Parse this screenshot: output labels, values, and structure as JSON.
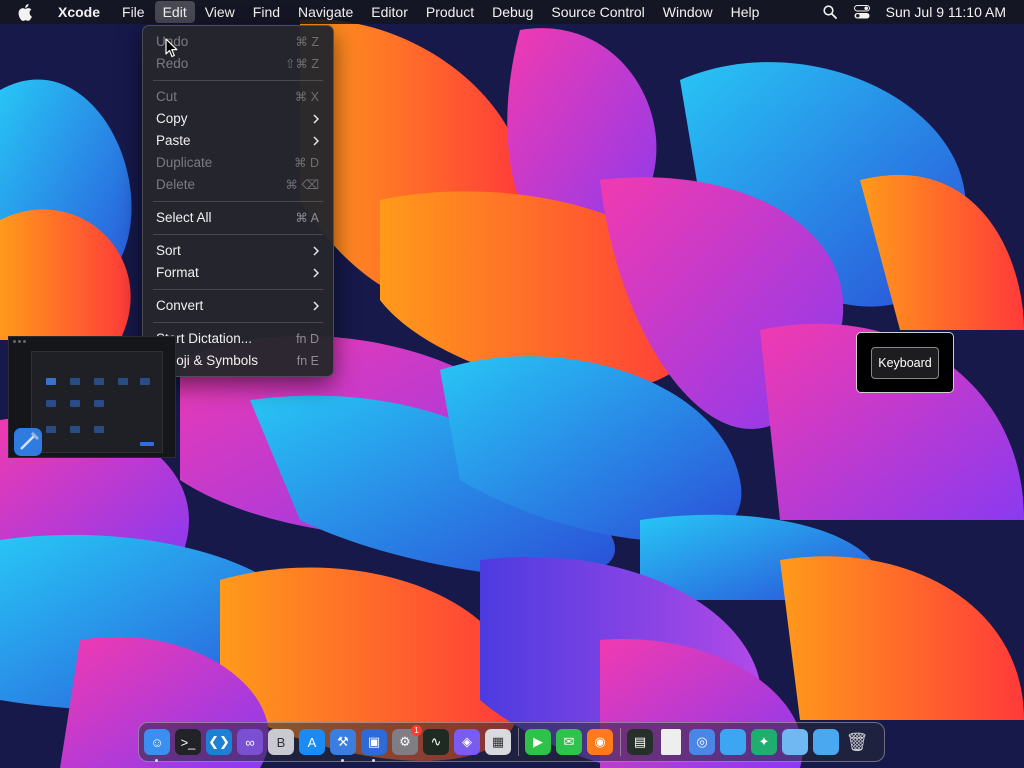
{
  "menubar": {
    "app_name": "Xcode",
    "items": [
      "File",
      "Edit",
      "View",
      "Find",
      "Navigate",
      "Editor",
      "Product",
      "Debug",
      "Source Control",
      "Window",
      "Help"
    ],
    "active_item": "Edit",
    "clock": "Sun Jul 9  11:10 AM"
  },
  "edit_menu": {
    "items": [
      {
        "label": "Undo",
        "shortcut": "⌘ Z",
        "disabled": true
      },
      {
        "label": "Redo",
        "shortcut": "⇧⌘ Z",
        "disabled": true
      },
      {
        "label": "Cut",
        "shortcut": "⌘ X",
        "disabled": true
      },
      {
        "label": "Copy",
        "submenu": true
      },
      {
        "label": "Paste",
        "submenu": true
      },
      {
        "label": "Duplicate",
        "shortcut": "⌘ D",
        "disabled": true
      },
      {
        "label": "Delete",
        "shortcut": "⌘ ⌫",
        "disabled": true
      },
      {
        "label": "Select All",
        "shortcut": "⌘ A"
      },
      {
        "label": "Sort",
        "submenu": true
      },
      {
        "label": "Format",
        "submenu": true
      },
      {
        "label": "Convert",
        "submenu": true
      },
      {
        "label": "Start Dictation...",
        "shortcut": "fn D"
      },
      {
        "label": "Emoji & Symbols",
        "shortcut": "fn E"
      }
    ]
  },
  "keyboard_overlay": {
    "label": "Keyboard"
  },
  "dock": {
    "apps": [
      {
        "name": "finder-icon",
        "color": "#3b8ff0",
        "running": true
      },
      {
        "name": "terminal-icon",
        "color": "#222326"
      },
      {
        "name": "vscode-icon",
        "color": "#1f7fd4"
      },
      {
        "name": "visual-studio-icon",
        "color": "#7b4fd1"
      },
      {
        "name": "bbedit-icon",
        "color": "#c9c9d2"
      },
      {
        "name": "app-store-icon",
        "color": "#1a8af5"
      },
      {
        "name": "xcode-icon",
        "color": "#3b7ee0",
        "running": true
      },
      {
        "name": "simulator-icon",
        "color": "#2f6ad6",
        "running": true
      },
      {
        "name": "system-settings-icon",
        "color": "#7e7e84",
        "badge": "1"
      },
      {
        "name": "activity-monitor-icon",
        "color": "#1e2a22"
      },
      {
        "name": "layers-icon",
        "color": "#7b5cf0"
      },
      {
        "name": "launchpad-icon",
        "color": "#d9d9e0"
      },
      {
        "name": "facetime-icon",
        "color": "#2ec24a"
      },
      {
        "name": "messages-icon",
        "color": "#30c24e"
      },
      {
        "name": "firefox-icon",
        "color": "#ff7b1a"
      },
      {
        "name": "console-icon",
        "color": "#26302a"
      },
      {
        "name": "document-icon",
        "color": "#eeeeee"
      },
      {
        "name": "chrome-icon",
        "color": "#4a86e8"
      },
      {
        "name": "folder-icon",
        "color": "#3da6f2"
      },
      {
        "name": "green-app-icon",
        "color": "#1fae6e"
      },
      {
        "name": "documents-folder-icon",
        "color": "#6fb8f2"
      },
      {
        "name": "downloads-folder-icon",
        "color": "#4aa8f0"
      },
      {
        "name": "trash-icon",
        "color": "#a9a9ae"
      }
    ]
  }
}
